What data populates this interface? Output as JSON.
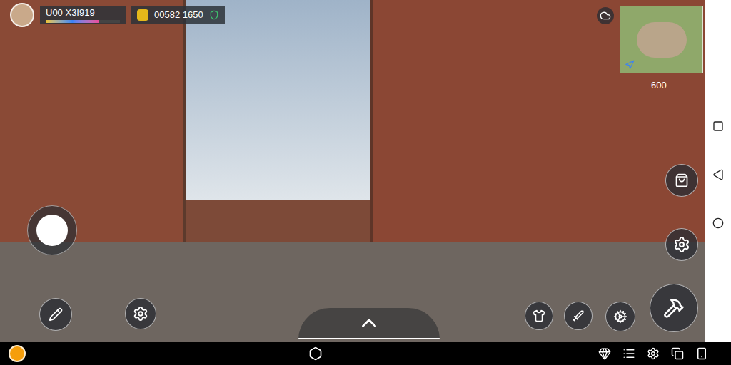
{
  "hud": {
    "player": {
      "name": "U00 X3I919",
      "level": 0.72
    },
    "currency": {
      "amount": "00582 1650"
    }
  },
  "minimap": {
    "label": "600"
  }
}
